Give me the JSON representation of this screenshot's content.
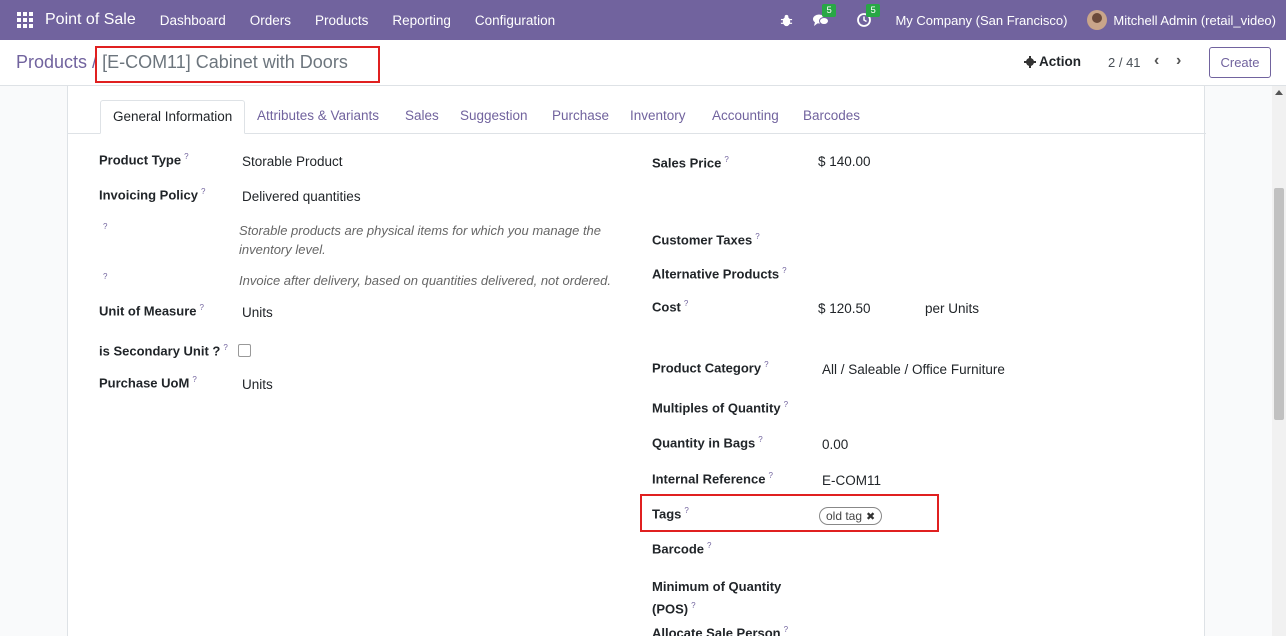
{
  "navbar": {
    "app_title": "Point of Sale",
    "menu": [
      "Dashboard",
      "Orders",
      "Products",
      "Reporting",
      "Configuration"
    ],
    "messages_badge": "5",
    "activities_badge": "5",
    "company": "My Company (San Francisco)",
    "user": "Mitchell Admin (retail_video)"
  },
  "control": {
    "breadcrumb_parent": "Products",
    "breadcrumb_sep": "/",
    "breadcrumb_current": "[E-COM11] Cabinet with Doors",
    "action_label": "Action",
    "pager": "2 / 41",
    "create_label": "Create"
  },
  "tabs": [
    "General Information",
    "Attributes & Variants",
    "Sales",
    "Suggestion",
    "Purchase",
    "Inventory",
    "Accounting",
    "Barcodes"
  ],
  "left": {
    "product_type_label": "Product Type",
    "product_type_value": "Storable Product",
    "invoicing_policy_label": "Invoicing Policy",
    "invoicing_policy_value": "Delivered quantities",
    "help_storable": "Storable products are physical items for which you manage the inventory level.",
    "help_invoice": "Invoice after delivery, based on quantities delivered, not ordered.",
    "uom_label": "Unit of Measure",
    "uom_value": "Units",
    "secondary_unit_label": "is Secondary Unit ?",
    "purchase_uom_label": "Purchase UoM",
    "purchase_uom_value": "Units"
  },
  "right": {
    "sales_price_label": "Sales Price",
    "sales_price_value": "$ 140.00",
    "customer_taxes_label": "Customer Taxes",
    "alternative_products_label": "Alternative Products",
    "cost_label": "Cost",
    "cost_value": "$ 120.50",
    "cost_unit": "per Units",
    "product_category_label": "Product Category",
    "product_category_value": "All / Saleable / Office Furniture",
    "multiples_label": "Multiples of Quantity",
    "qty_bags_label": "Quantity in Bags",
    "qty_bags_value": "0.00",
    "internal_ref_label": "Internal Reference",
    "internal_ref_value": "E-COM11",
    "tags_label": "Tags",
    "tag_value": "old tag",
    "barcode_label": "Barcode",
    "min_qty_label_1": "Minimum of Quantity",
    "min_qty_label_2": "(POS)",
    "allocate_label": "Allocate Sale Person"
  },
  "help_mark": "?",
  "colors": {
    "navbar": "#71639e",
    "highlight": "#e02020",
    "badge": "#28a745"
  }
}
